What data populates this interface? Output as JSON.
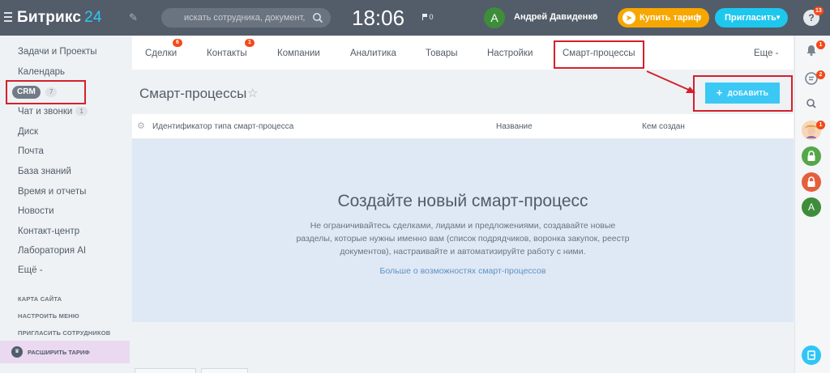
{
  "header": {
    "logo_name": "Битрикс",
    "logo_num": "24",
    "search_placeholder": "искать сотрудника, документ, проч...",
    "clock": "18:06",
    "flag_count": "0",
    "user_initial": "A",
    "user_name": "Андрей Давиденко",
    "buy_label": "Купить тариф",
    "invite_label": "Пригласить"
  },
  "right_panel": {
    "help_badge": "13",
    "bell_badge": "1",
    "chat_badge": "2",
    "girl_badge": "1",
    "avatar_initial": "A"
  },
  "sidebar": {
    "items": [
      {
        "label": "Задачи и Проекты"
      },
      {
        "label": "Календарь"
      },
      {
        "label": "CRM",
        "count": "7"
      },
      {
        "label": "Чат и звонки",
        "count": "1"
      },
      {
        "label": "Диск"
      },
      {
        "label": "Почта"
      },
      {
        "label": "База знаний"
      },
      {
        "label": "Время и отчеты"
      },
      {
        "label": "Новости"
      },
      {
        "label": "Контакт-центр"
      },
      {
        "label": "Лаборатория AI"
      },
      {
        "label": "Ещё -"
      }
    ],
    "sitemap": "КАРТА САЙТА",
    "configure": "НАСТРОИТЬ МЕНЮ",
    "invite": "ПРИГЛАСИТЬ СОТРУДНИКОВ",
    "upgrade": "РАСШИРИТЬ ТАРИФ"
  },
  "tabs": [
    {
      "label": "Сделки",
      "badge": "6"
    },
    {
      "label": "Контакты",
      "badge": "1"
    },
    {
      "label": "Компании"
    },
    {
      "label": "Аналитика"
    },
    {
      "label": "Товары"
    },
    {
      "label": "Настройки"
    },
    {
      "label": "Смарт-процессы"
    },
    {
      "label": "Еще -"
    }
  ],
  "main": {
    "title": "Смарт-процессы",
    "add_button": "ДОБАВИТЬ",
    "columns": [
      "Идентификатор типа смарт-процесса",
      "Название",
      "Кем создан"
    ],
    "empty_title": "Создайте новый смарт-процесс",
    "empty_text": "Не ограничивайтесь сделками, лидами и предложениями, создавайте новые разделы, которые нужны именно вам (список подрядчиков, воронка закупок, реестр документов), настраивайте и автоматизируйте работу с ними.",
    "empty_link": "Больше о возможностях смарт-процессов"
  },
  "colors": {
    "topbar": "#535c69",
    "accent": "#2fc6f6",
    "buy": "#f7a700",
    "invite": "#1ec7ed",
    "highlight": "#d4202b",
    "empty_bg": "#dfe8f5"
  }
}
